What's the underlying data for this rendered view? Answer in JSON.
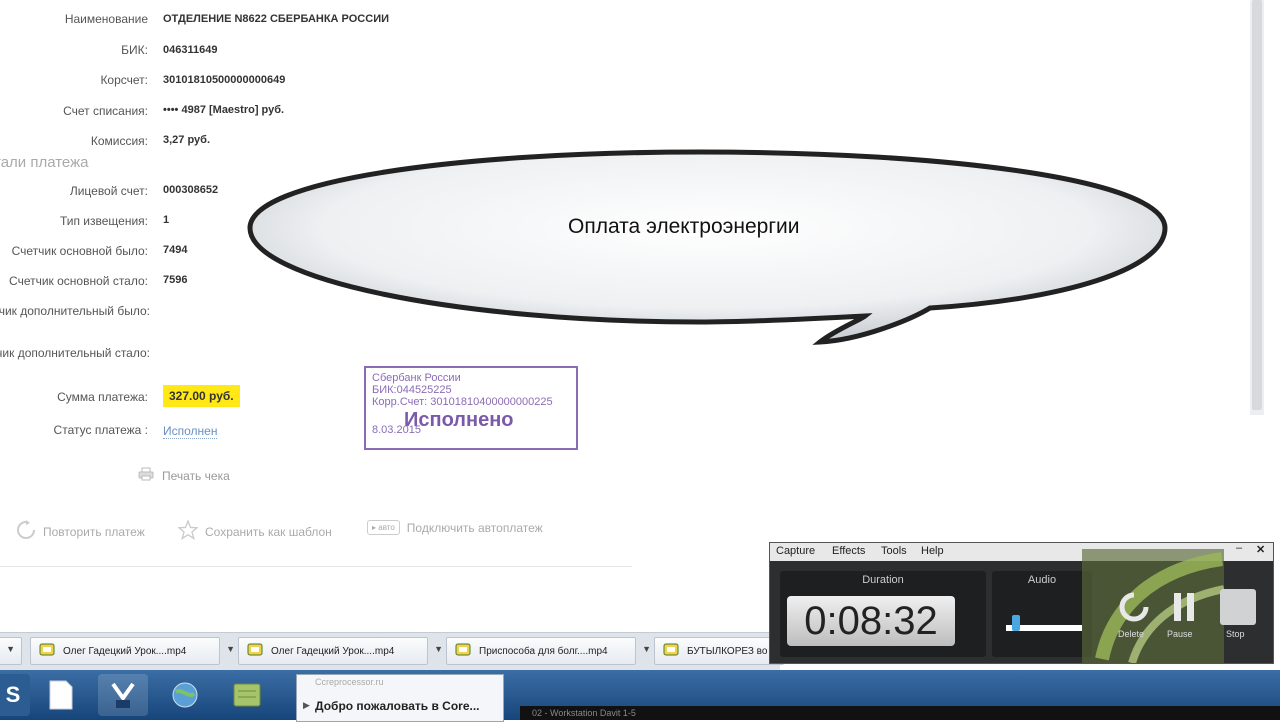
{
  "details": {
    "fields": [
      {
        "label": "Наименование",
        "value": "ОТДЕЛЕНИЕ N8622 СБЕРБАНКА РОССИИ"
      },
      {
        "label": "БИК:",
        "value": "046311649"
      },
      {
        "label": "Корсчет:",
        "value": "30101810500000000649"
      },
      {
        "label": "Счет списания:",
        "value": "•••• 4987  [Maestro]  руб."
      },
      {
        "label": "Комиссия:",
        "value": "3,27 руб."
      }
    ],
    "section_title": "тали платежа",
    "payment_fields": [
      {
        "label": "Лицевой счет:",
        "value": "000308652"
      },
      {
        "label": "Тип извещения:",
        "value": "1"
      },
      {
        "label": "Счетчик основной было:",
        "value": "7494"
      },
      {
        "label": "Счетчик основной стало:",
        "value": "7596"
      },
      {
        "label": "Счетчик дополнительный было:",
        "value": ""
      },
      {
        "label": "Счетчик дополнительный стало:",
        "value": ""
      }
    ],
    "sum_label": "Сумма платежа:",
    "sum_value": "327.00 руб.",
    "status_label": "Статус платежа :",
    "status_value": "Исполнен"
  },
  "stamp": {
    "line1": "Сбербанк России",
    "line2": "БИК:044525225",
    "line3": "Корр.Счет: 30101810400000000225",
    "big": "Исполнено",
    "date": "8.03.2015"
  },
  "actions": {
    "print": "Печать чека",
    "repeat": "Повторить платеж",
    "save_template": "Сохранить как шаблон",
    "auto_badge": "авто",
    "autopay": "Подключить автоплатеж"
  },
  "callout": {
    "text": "Оплата электроэнергии"
  },
  "downloads": [
    {
      "name": "Олег Гадецкий Урок....mp4"
    },
    {
      "name": "Олег Гадецкий Урок....mp4"
    },
    {
      "name": "Приспособа для болг....mp4"
    },
    {
      "name": "БУТЫЛКОРЕЗ во"
    }
  ],
  "popup": {
    "subtitle": "Ccreprocessor.ru",
    "title": "Добро пожаловать в Core..."
  },
  "darkbar": {
    "text": "02 - Workstation Davit 1-5"
  },
  "recorder": {
    "menu": [
      "Capture",
      "Effects",
      "Tools",
      "Help"
    ],
    "duration_label": "Duration",
    "duration": "0:08:32",
    "audio_label": "Audio",
    "delete_label": "Delete",
    "pause_label": "Pause",
    "stop_label": "Stop"
  },
  "colors": {
    "highlight": "#ffe816",
    "stamp": "#8c6bb6",
    "link": "#6a8fc0",
    "taskbar": "#16457a"
  }
}
